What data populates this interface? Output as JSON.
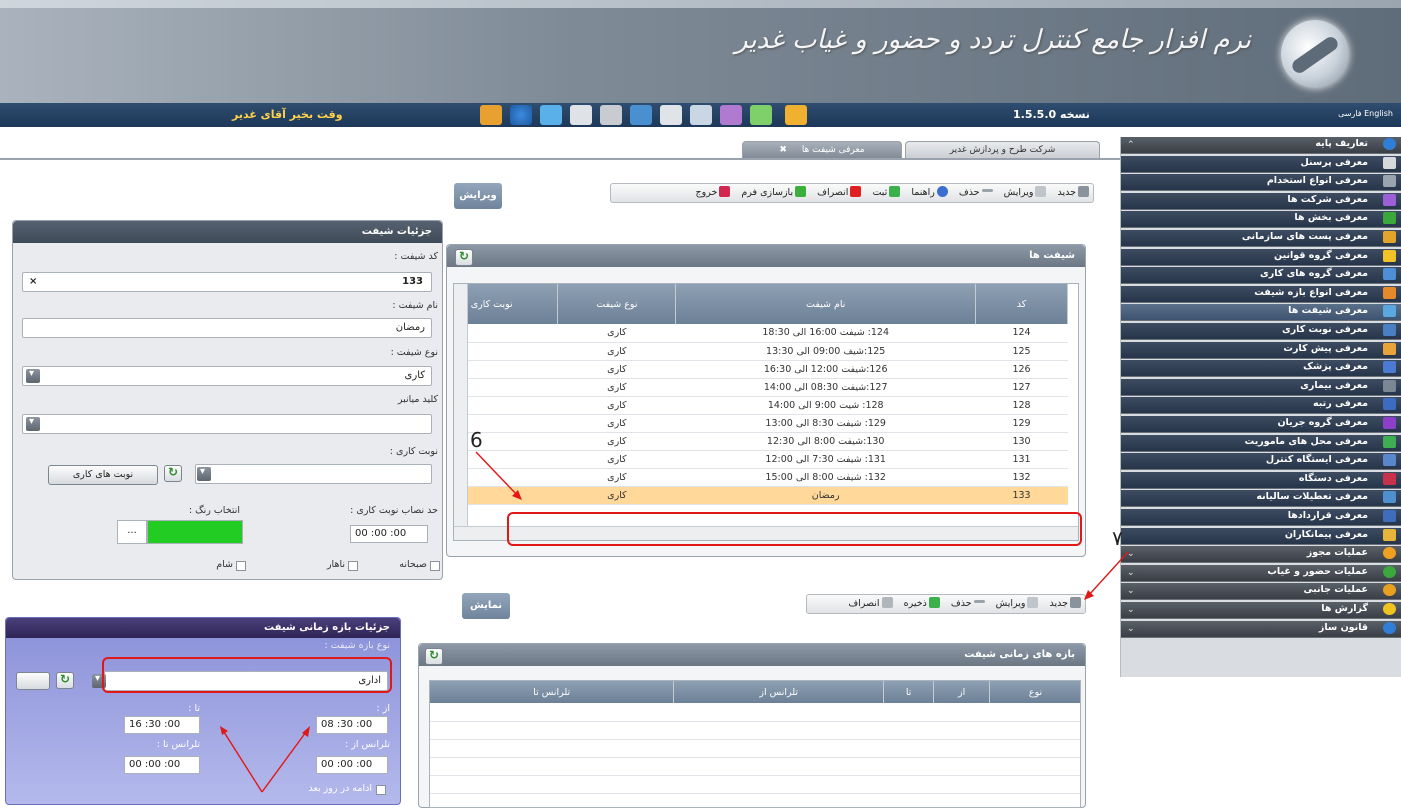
{
  "header": {
    "title": "نرم افزار جامع کنترل تردد و حضور و غیاب غدیر",
    "welcome": "وقت بخیر آقای غدیر",
    "version": "نسخه 1.5.5.0",
    "lang": "فارسی English"
  },
  "tabs": [
    {
      "label": "شرکت طرح و پردازش غدیر"
    },
    {
      "label": "معرفی شیفت ها"
    }
  ],
  "tab_close": "✖",
  "toolbar_main": {
    "new": "جدید",
    "edit": "ویرایش",
    "delete": "حذف",
    "help": "راهنما",
    "save": "ثبت",
    "cancel": "انصراف",
    "reload": "بازسازی فرم",
    "exit": "خروج"
  },
  "edit_label": "ویرایش",
  "show_label": "نمایش",
  "shifts_panel": {
    "title": "شیفت ها",
    "columns": [
      "کد",
      "نام شیفت",
      "نوع شیفت",
      "نوبت کاری"
    ],
    "rows": [
      {
        "code": "124",
        "name": "124: شیفت 16:00 الی 18:30",
        "type": "کاری"
      },
      {
        "code": "125",
        "name": "125:شیف 09:00 الی 13:30",
        "type": "کاری"
      },
      {
        "code": "126",
        "name": "126:شیفت 12:00 الی 16:30",
        "type": "کاری"
      },
      {
        "code": "127",
        "name": "127:شیفت 08:30 الی 14:00",
        "type": "کاری"
      },
      {
        "code": "128",
        "name": "128: شیت 9:00 الی 14:00",
        "type": "کاری"
      },
      {
        "code": "129",
        "name": "129: شیفت 8:30 الی 13:00",
        "type": "کاری"
      },
      {
        "code": "130",
        "name": "130:شیفت 8:00 الی 12:30",
        "type": "کاری"
      },
      {
        "code": "131",
        "name": "131: شیفت 7:30 الی 12:00",
        "type": "کاری"
      },
      {
        "code": "132",
        "name": "132: شیفت 8:00 الی 15:00",
        "type": "کاری"
      },
      {
        "code": "133",
        "name": "رمضان",
        "type": "کاری"
      }
    ]
  },
  "shift_details": {
    "title": "جزئیات شیفت",
    "code_label": "کد شیفت :",
    "code_value": "133",
    "clear": "×",
    "name_label": "نام شیفت :",
    "name_value": "رمضان",
    "type_label": "نوع شیفت :",
    "type_value": "کاری",
    "alt_key_label": "کلید میانبر",
    "alt_key_value": "",
    "work_turn_label": "نوبت کاری :",
    "work_turn_value": "",
    "work_turns_button": "نوبت های کاری",
    "min_label": "حد نصاب نوبت کاری :",
    "min_value": "00 :00 :00",
    "color_label": "انتخاب رنگ :",
    "color_button": "...",
    "color_value": "#22cc22",
    "meals": [
      "صبحانه",
      "ناهار",
      "شام"
    ]
  },
  "toolbar_second": {
    "new": "جدید",
    "edit": "ویرایش",
    "delete": "حذف",
    "save": "ذخیره",
    "cancel": "انصراف"
  },
  "periods_panel": {
    "title": "بازه های زمانی شیفت",
    "columns": [
      "نوع",
      "از",
      "تا",
      "تلرانس از",
      "تلرانس تا"
    ]
  },
  "period_details": {
    "title": "جزئیات بازه زمانی شیفت",
    "type_label": "نوع بازه شیفت :",
    "type_value": "اداری",
    "from_label": "از :",
    "from_value": "08 :30 :00",
    "to_label": "تا :",
    "to_value": "16 :30 :00",
    "tol_from_label": "تلرانس از :",
    "tol_from_value": "00 :00 :00",
    "tol_to_label": "تلرانس تا :",
    "tol_to_value": "00 :00 :00",
    "next_day": "ادامه در روز بعد"
  },
  "annotations": {
    "six": "6",
    "seven": "٧"
  },
  "sidebar": [
    {
      "label": "تعاریف پایه",
      "kind": "cat",
      "color": "#2f7fd8"
    },
    {
      "label": "معرفی پرسنل",
      "kind": "sub",
      "color": "#d6d8db"
    },
    {
      "label": "معرفی انواع استخدام",
      "kind": "sub",
      "color": "#9aa4ae"
    },
    {
      "label": "معرفی شرکت ها",
      "kind": "sub",
      "color": "#9b5fd6"
    },
    {
      "label": "معرفی بخش ها",
      "kind": "sub",
      "color": "#3aa83a"
    },
    {
      "label": "معرفی پست های سازمانی",
      "kind": "sub",
      "color": "#e2a42a"
    },
    {
      "label": "معرفی گروه قوانین",
      "kind": "sub",
      "color": "#f0c428"
    },
    {
      "label": "معرفی گروه های کاری",
      "kind": "sub",
      "color": "#4d8fd6"
    },
    {
      "label": "معرفی انواع بازه شیفت",
      "kind": "sub",
      "color": "#e58a2a"
    },
    {
      "label": "معرفی شیفت ها",
      "kind": "active",
      "color": "#5ba8e0"
    },
    {
      "label": "معرفی نوبت کاری",
      "kind": "sub",
      "color": "#4a7fc4"
    },
    {
      "label": "معرفی پیش کارت",
      "kind": "sub",
      "color": "#e8a43a"
    },
    {
      "label": "معرفی پزشک",
      "kind": "sub",
      "color": "#4c7ad3"
    },
    {
      "label": "معرفی بیماری",
      "kind": "sub",
      "color": "#7b8794"
    },
    {
      "label": "معرفی رتبه",
      "kind": "sub",
      "color": "#3c6bc2"
    },
    {
      "label": "معرفی گروه جریان",
      "kind": "sub",
      "color": "#8c3fc8"
    },
    {
      "label": "معرفی محل های ماموریت",
      "kind": "sub",
      "color": "#3fae52"
    },
    {
      "label": "معرفی ایستگاه کنترل",
      "kind": "sub",
      "color": "#5a86cc"
    },
    {
      "label": "معرفی دستگاه",
      "kind": "sub",
      "color": "#c8324a"
    },
    {
      "label": "معرفی تعطیلات سالیانه",
      "kind": "sub",
      "color": "#4e8fd0"
    },
    {
      "label": "معرفی قراردادها",
      "kind": "sub",
      "color": "#3f6dbb"
    },
    {
      "label": "معرفی پیمانکاران",
      "kind": "sub",
      "color": "#e6b53a"
    },
    {
      "label": "عملیات مجوز",
      "kind": "cat",
      "color": "#f0a020"
    },
    {
      "label": "عملیات حضور و غیاب",
      "kind": "cat",
      "color": "#3aa83a"
    },
    {
      "label": "عملیات جانبی",
      "kind": "cat",
      "color": "#e8a020"
    },
    {
      "label": "گزارش ها",
      "kind": "cat",
      "color": "#f0c420"
    },
    {
      "label": "قانون ساز",
      "kind": "cat",
      "color": "#2f7fd8"
    }
  ]
}
